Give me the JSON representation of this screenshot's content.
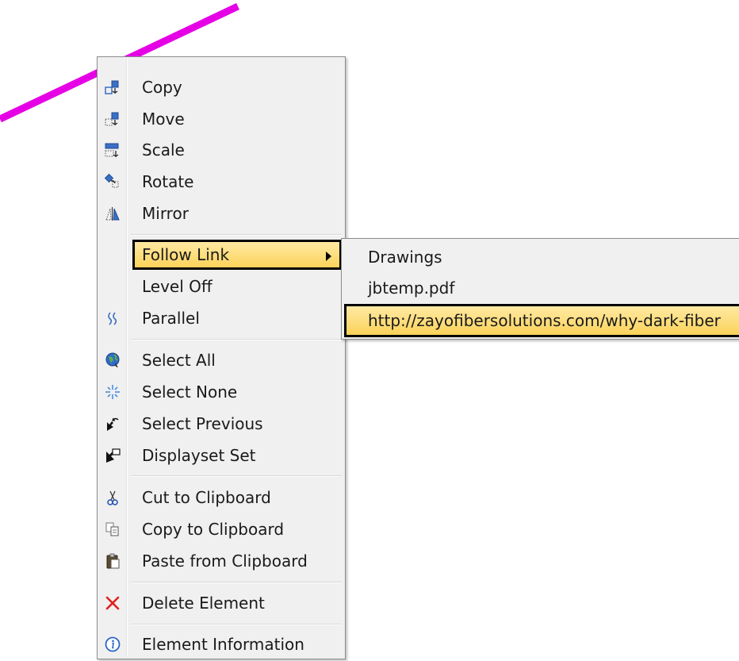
{
  "menu": {
    "items": [
      {
        "label": "Copy",
        "icon": "copy-element-icon"
      },
      {
        "label": "Move",
        "icon": "move-element-icon"
      },
      {
        "label": "Scale",
        "icon": "scale-element-icon"
      },
      {
        "label": "Rotate",
        "icon": "rotate-element-icon"
      },
      {
        "label": "Mirror",
        "icon": "mirror-element-icon"
      },
      {
        "label": "Follow Link",
        "icon": "",
        "has_submenu": true,
        "highlighted": true
      },
      {
        "label": "Level Off",
        "icon": ""
      },
      {
        "label": "Parallel",
        "icon": "parallel-icon"
      },
      {
        "label": "Select All",
        "icon": "globe-select-all-icon"
      },
      {
        "label": "Select None",
        "icon": "sparkle-select-none-icon"
      },
      {
        "label": "Select Previous",
        "icon": "arrow-select-previous-icon"
      },
      {
        "label": "Displayset Set",
        "icon": "arrow-displayset-icon"
      },
      {
        "label": "Cut to Clipboard",
        "icon": "scissors-icon"
      },
      {
        "label": "Copy to Clipboard",
        "icon": "copy-clipboard-icon"
      },
      {
        "label": "Paste from Clipboard",
        "icon": "clipboard-paste-icon"
      },
      {
        "label": "Delete Element",
        "icon": "red-x-delete-icon"
      },
      {
        "label": "Element Information",
        "icon": "info-icon"
      }
    ]
  },
  "submenu": {
    "items": [
      {
        "label": "Drawings"
      },
      {
        "label": "jbtemp.pdf"
      },
      {
        "label": "http://zayofibersolutions.com/why-dark-fiber",
        "highlighted": true
      }
    ]
  },
  "colors": {
    "highlight_top": "#ffe9a3",
    "highlight_bottom": "#fbd35a",
    "drawing_line": "#e600e6",
    "delete_red": "#e02020",
    "info_blue": "#2a66c9"
  }
}
